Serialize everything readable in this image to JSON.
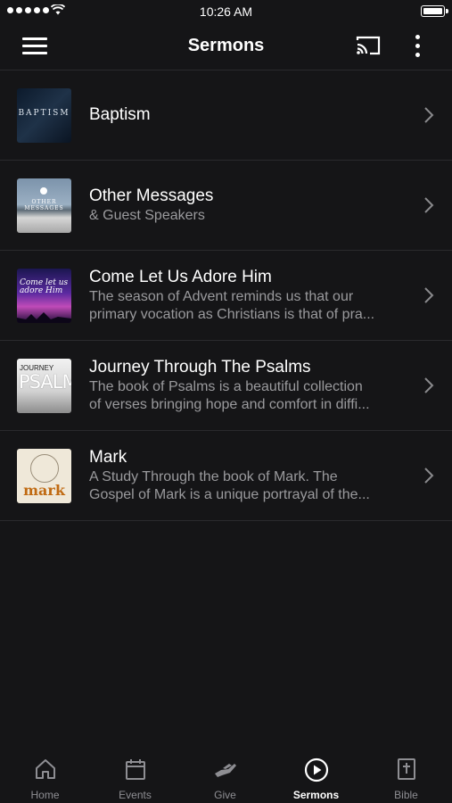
{
  "status_bar": {
    "time": "10:26 AM"
  },
  "nav": {
    "title": "Sermons"
  },
  "sermons": [
    {
      "title": "Baptism",
      "subtitle": "",
      "thumb_text": "BAPTISM"
    },
    {
      "title": "Other Messages",
      "subtitle": "& Guest Speakers",
      "thumb_text": "OTHER MESSAGES"
    },
    {
      "title": "Come Let Us Adore Him",
      "subtitle": "The season of Advent reminds us that our",
      "subtitle2": "primary vocation as Christians is that of pra...",
      "thumb_text": "Come let us adore Him"
    },
    {
      "title": "Journey Through The Psalms",
      "subtitle": "The book of Psalms is a beautiful collection",
      "subtitle2": "of verses bringing hope and comfort in diffi...",
      "thumb_text_small": "JOURNEY",
      "thumb_text": "PSALMS"
    },
    {
      "title": "Mark",
      "subtitle": "A Study Through the book of Mark.  The",
      "subtitle2": "Gospel of Mark is a unique portrayal of the...",
      "thumb_text": "mark"
    }
  ],
  "tabs": [
    {
      "label": "Home",
      "icon": "home-icon",
      "active": false
    },
    {
      "label": "Events",
      "icon": "calendar-icon",
      "active": false
    },
    {
      "label": "Give",
      "icon": "give-icon",
      "active": false
    },
    {
      "label": "Sermons",
      "icon": "play-circle-icon",
      "active": true
    },
    {
      "label": "Bible",
      "icon": "bible-icon",
      "active": false
    }
  ]
}
